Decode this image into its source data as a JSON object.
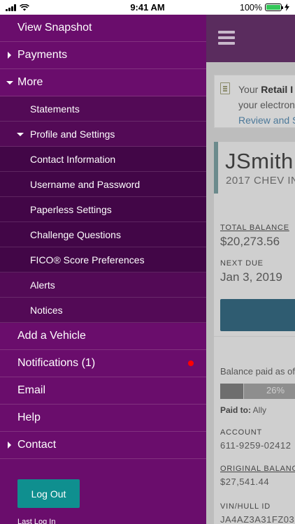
{
  "status_bar": {
    "time": "9:41 AM",
    "battery": "100%"
  },
  "drawer": {
    "items": [
      {
        "label": "View Snapshot"
      },
      {
        "label": "Payments"
      },
      {
        "label": "More"
      },
      {
        "label": "Statements"
      },
      {
        "label": "Profile and Settings"
      },
      {
        "label": "Contact Information"
      },
      {
        "label": "Username and Password"
      },
      {
        "label": "Paperless Settings"
      },
      {
        "label": "Challenge Questions"
      },
      {
        "label": "FICO® Score Preferences"
      },
      {
        "label": "Alerts"
      },
      {
        "label": "Notices"
      },
      {
        "label": "Add a Vehicle"
      },
      {
        "label": "Notifications (1)"
      },
      {
        "label": "Email"
      },
      {
        "label": "Help"
      },
      {
        "label": "Contact"
      }
    ],
    "logout_label": "Log Out",
    "last_login_label": "Last Log In"
  },
  "background": {
    "banner": {
      "line1_prefix": "Your ",
      "line1_bold": "Retail I",
      "line2": "your electron",
      "link": "Review and S"
    },
    "account": {
      "nickname": "JSmith",
      "vehicle": "2017 CHEV IN",
      "total_balance_label": "TOTAL BALANCE",
      "total_balance": "$20,273.56",
      "next_due_label": "NEXT DUE",
      "next_due": "Jan 3, 2019",
      "balance_paid_label": "Balance paid as of",
      "progress_label": "26%",
      "progress_value": 26,
      "paid_to_label": "Paid to:",
      "paid_to": "Ally",
      "account_label": "ACCOUNT",
      "account_number": "611-9259-02412",
      "original_balance_label": "ORIGINAL BALANC",
      "original_balance": "$27,541.44",
      "vin_label": "VIN/HULL ID",
      "vin": "JA4AZ3A31FZ03"
    }
  }
}
